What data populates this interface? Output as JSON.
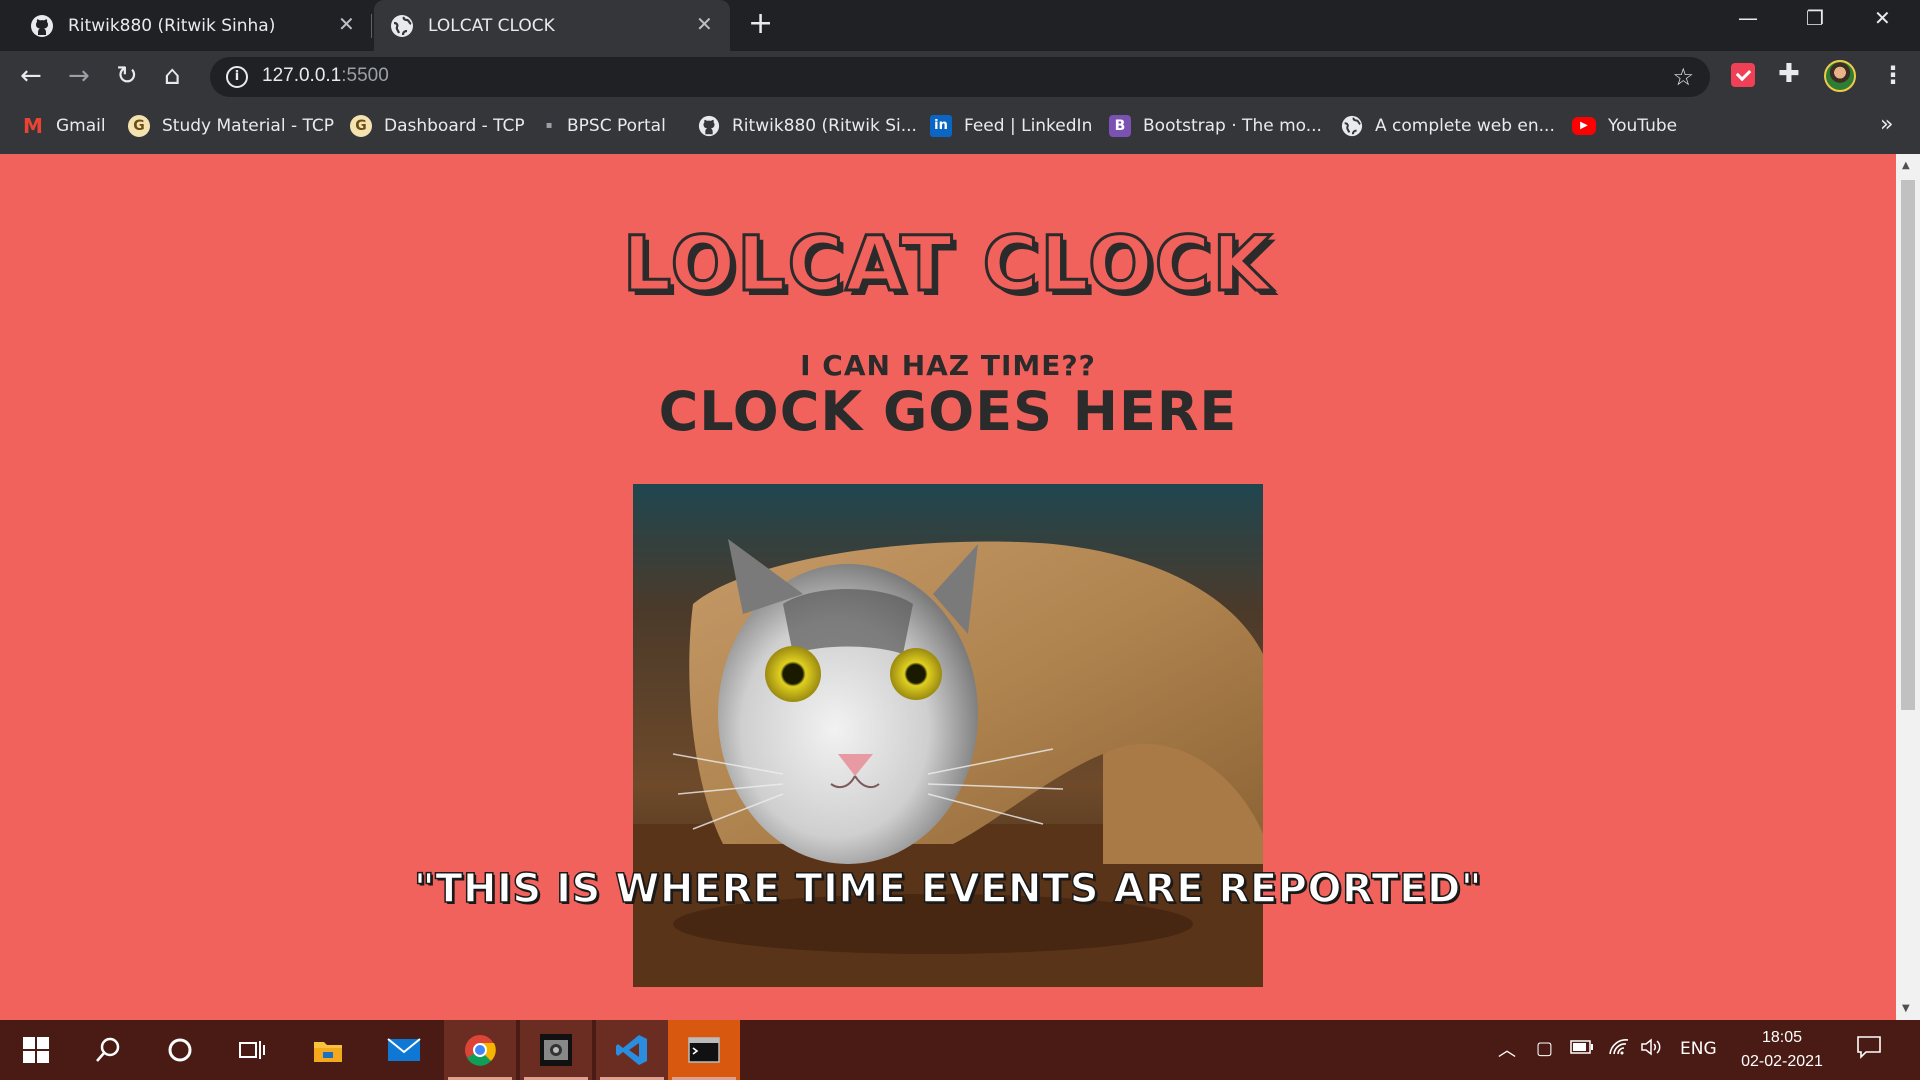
{
  "tabs": [
    {
      "title": "Ritwik880 (Ritwik Sinha)",
      "icon": "github-icon",
      "active": false
    },
    {
      "title": "LOLCAT CLOCK",
      "icon": "globe-icon",
      "active": true
    }
  ],
  "new_tab_label": "+",
  "window_controls": {
    "minimize": "—",
    "restore": "❐",
    "close": "✕"
  },
  "toolbar": {
    "back": "←",
    "forward": "→",
    "reload": "↻",
    "home": "⌂",
    "url_host": "127.0.0.1",
    "url_port": ":5500",
    "bookmark_star": "☆",
    "extensions": "✚",
    "menu": "⋮"
  },
  "bookmarks": [
    {
      "label": "Gmail",
      "icon": "gmail-icon",
      "color": "#ea4335"
    },
    {
      "label": "Study Material - TCP",
      "icon": "tcp-icon",
      "color": "#f4c542"
    },
    {
      "label": "Dashboard - TCP",
      "icon": "tcp-icon",
      "color": "#f4c542"
    },
    {
      "label": "BPSC Portal",
      "icon": "bpsc-icon",
      "color": "#9aa0a6"
    },
    {
      "label": "Ritwik880 (Ritwik Si...",
      "icon": "github-icon",
      "color": "#ffffff"
    },
    {
      "label": "Feed | LinkedIn",
      "icon": "linkedin-icon",
      "color": "#0a66c2"
    },
    {
      "label": "Bootstrap · The mo...",
      "icon": "bootstrap-icon",
      "color": "#7952b3"
    },
    {
      "label": "A complete web en...",
      "icon": "globe-icon",
      "color": "#ffffff"
    },
    {
      "label": "YouTube",
      "icon": "youtube-icon",
      "color": "#ff0000"
    }
  ],
  "bookmarks_overflow": "»",
  "page": {
    "heading": "LOLCAT CLOCK",
    "subheading": "I CAN HAZ TIME??",
    "clock_text": "CLOCK GOES HERE",
    "time_event_message": "\"THIS IS WHERE TIME EVENTS ARE REPORTED\"",
    "background_color": "#f2625c"
  },
  "taskbar": {
    "apps": [
      "windows-start-icon",
      "search-icon",
      "cortana-icon",
      "task-view-icon",
      "file-explorer-icon",
      "mail-icon",
      "chrome-icon",
      "photo-app-icon",
      "vscode-icon",
      "terminal-icon"
    ],
    "tray_language": "ENG",
    "time": "18:05",
    "date": "02-02-2021"
  }
}
